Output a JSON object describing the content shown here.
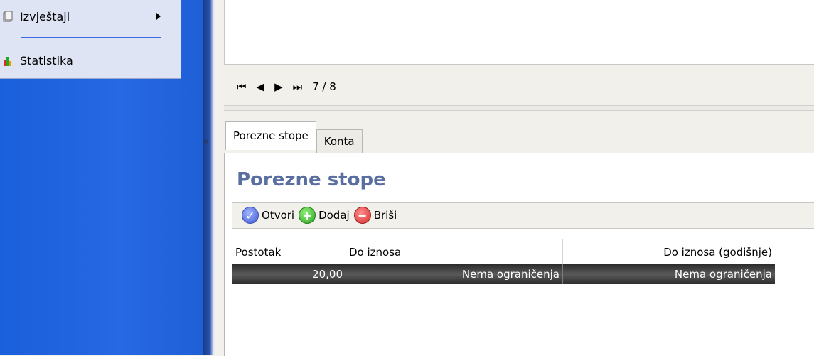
{
  "menu": {
    "items": [
      {
        "label": "Izvještaji",
        "icon": "reports-icon"
      },
      {
        "label": "Statistika",
        "icon": "statistics-icon"
      }
    ]
  },
  "navigator": {
    "first_icon": "first-icon",
    "prev_icon": "prev-icon",
    "next_icon": "next-icon",
    "last_icon": "last-icon",
    "counter": "7 / 8"
  },
  "tabs": [
    {
      "label": "Porezne stope",
      "active": true
    },
    {
      "label": "Konta",
      "active": false
    }
  ],
  "section": {
    "title": "Porezne stope"
  },
  "toolbar": {
    "open_label": "Otvori",
    "add_label": "Dodaj",
    "delete_label": "Briši"
  },
  "table": {
    "columns": [
      "Postotak",
      "Do iznosa",
      "Do iznosa (godišnje)"
    ],
    "rows": [
      [
        "20,00",
        "Nema ograničenja",
        "Nema ograničenja"
      ]
    ]
  },
  "colors": {
    "title": "#5a6ea0",
    "sidebar_blue": "#2768e4"
  }
}
